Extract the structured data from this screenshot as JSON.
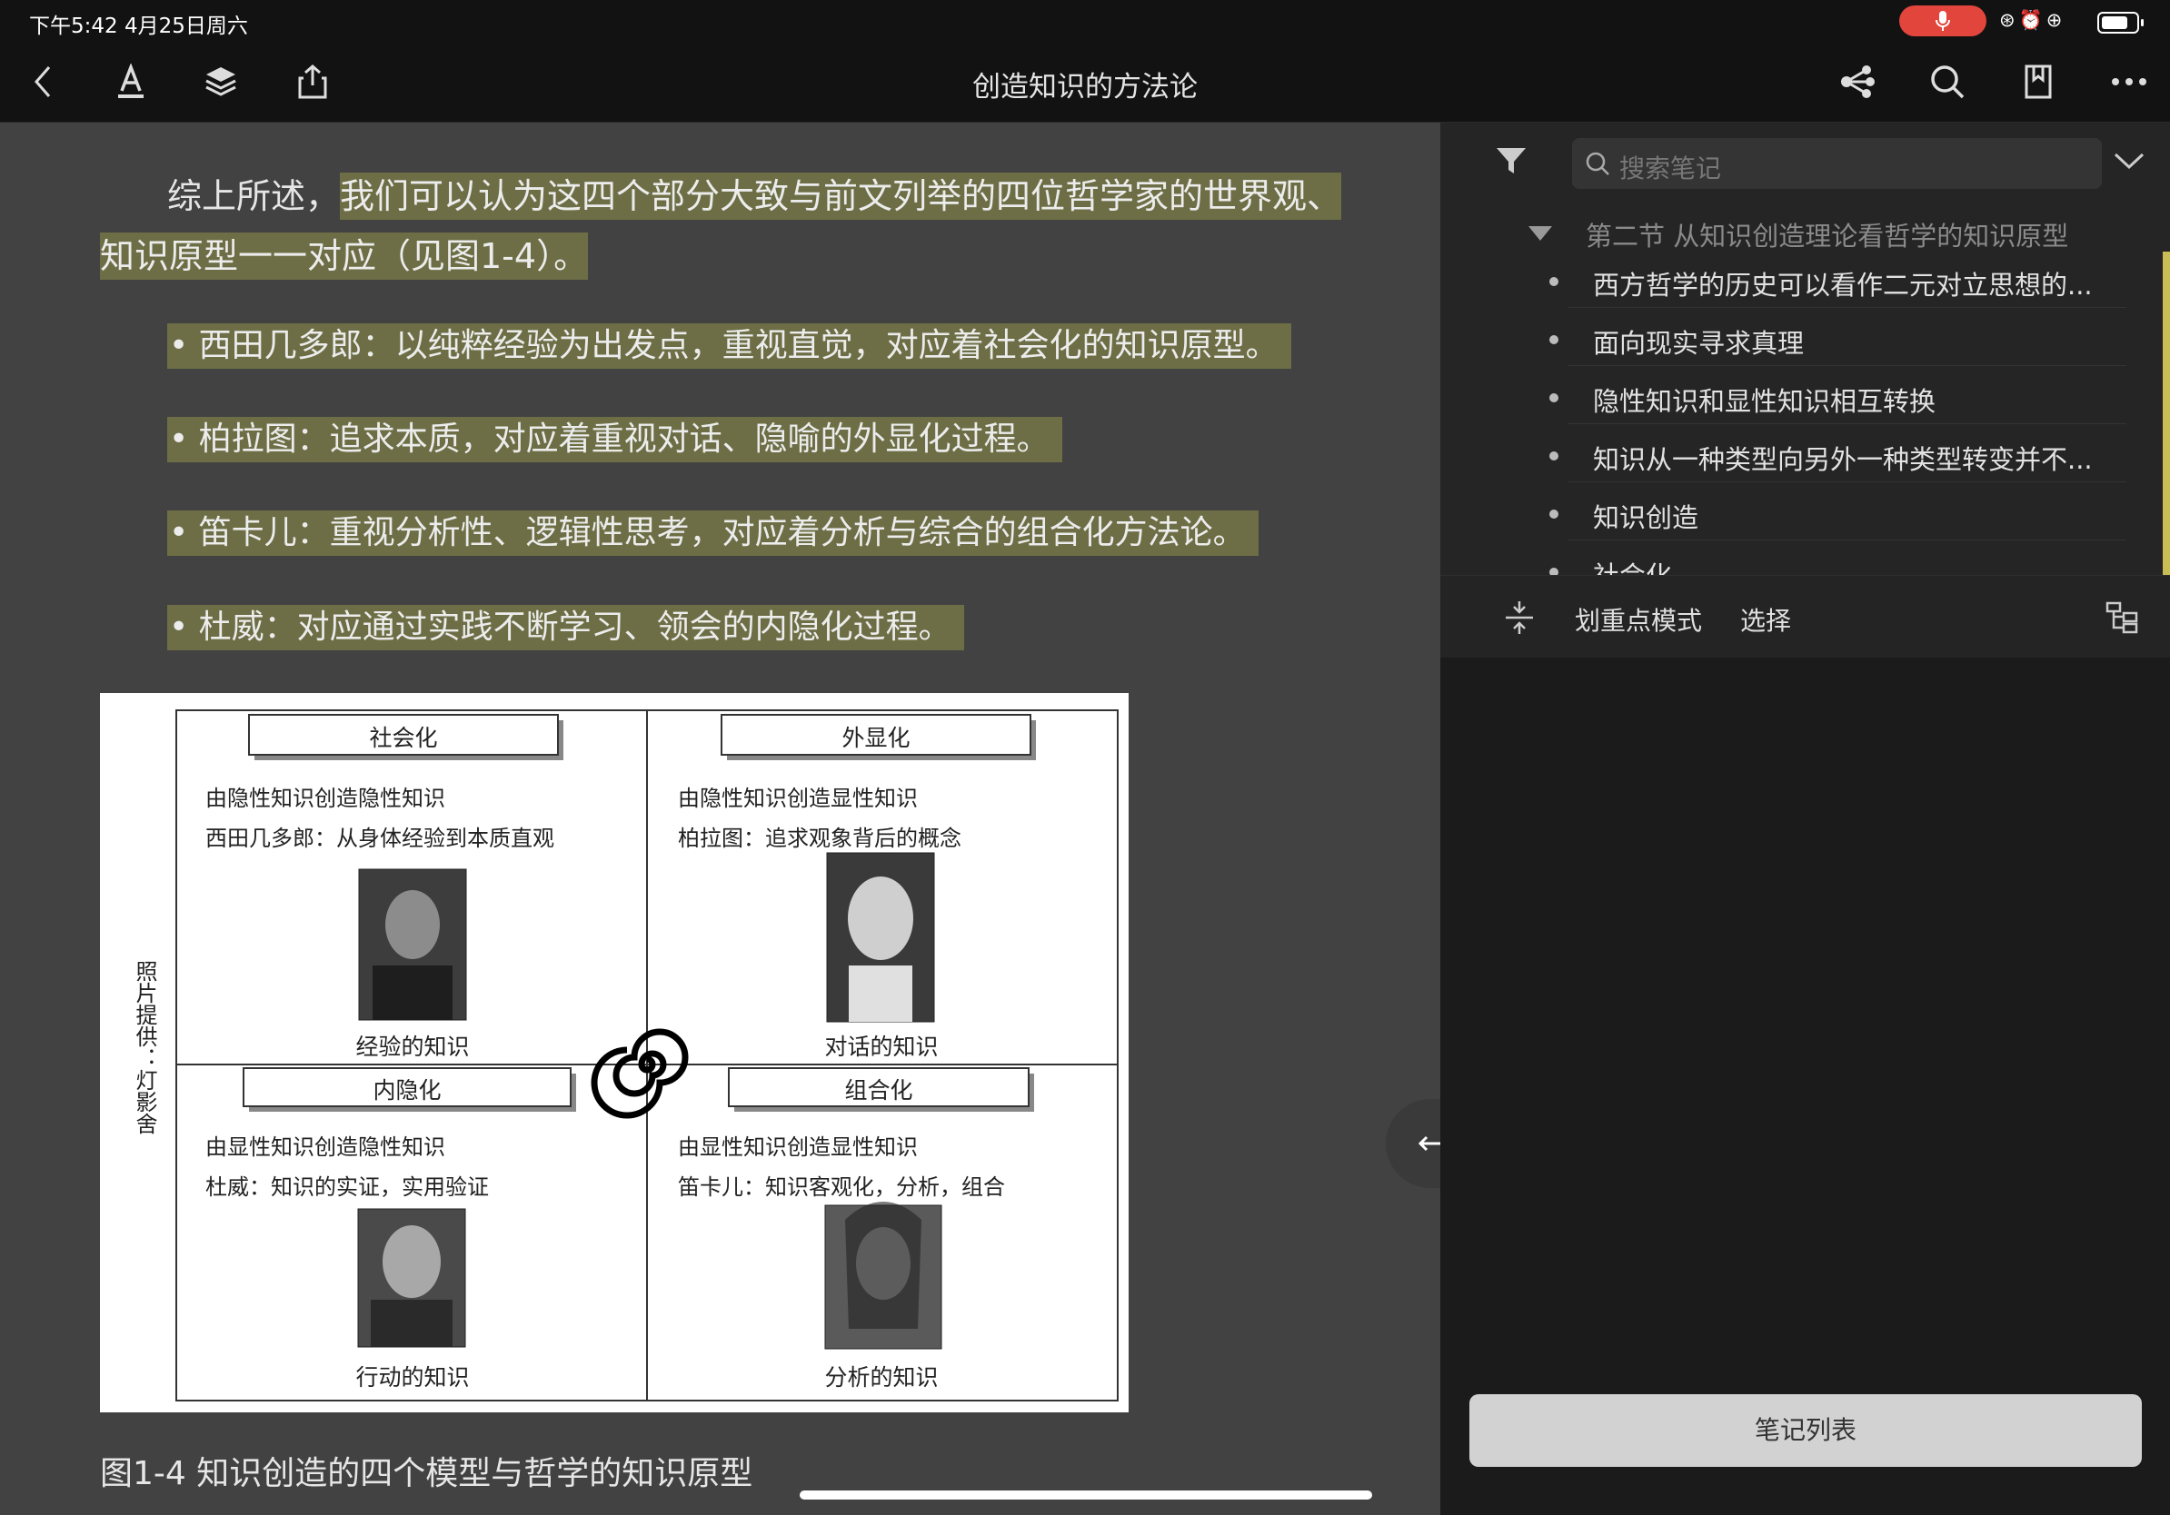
{
  "status_bar": {
    "time": "下午5:42  4月25日周六"
  },
  "toolbar": {
    "title": "创造知识的方法论"
  },
  "reader": {
    "para_plain": "综上所述，",
    "para_highlight": "我们可以认为这四个部分大致与前文列举的四位哲学家的世界观、知识原型一一对应（见图1-4）。",
    "bullets": [
      "• 西田几多郎：以纯粹经验为出发点，重视直觉，对应着社会化的知识原型。",
      "• 柏拉图：追求本质，对应着重视对话、隐喻的外显化过程。",
      "• 笛卡儿：重视分析性、逻辑性思考，对应着分析与综合的组合化方法论。",
      "• 杜威：对应通过实践不断学习、领会的内隐化过程。"
    ],
    "figure": {
      "side_label": "照片提供：灯影舍",
      "quadrants": [
        {
          "title": "社会化",
          "line1": "由隐性知识创造隐性知识",
          "line2": "西田几多郎：从身体经验到本质直观",
          "caption": "经验的知识"
        },
        {
          "title": "外显化",
          "line1": "由隐性知识创造显性知识",
          "line2": "柏拉图：追求观象背后的概念",
          "caption": "对话的知识"
        },
        {
          "title": "内隐化",
          "line1": "由显性知识创造隐性知识",
          "line2": "杜威：知识的实证，实用验证",
          "caption": "行动的知识"
        },
        {
          "title": "组合化",
          "line1": "由显性知识创造显性知识",
          "line2": "笛卡儿：知识客观化，分析，组合",
          "caption": "分析的知识"
        }
      ]
    },
    "figure_caption": "图1-4 知识创造的四个模型与哲学的知识原型"
  },
  "notes_panel": {
    "search_placeholder": "搜索笔记",
    "section_title": "第二节 从知识创造理论看哲学的知识原型",
    "items": [
      "西方哲学的历史可以看作二元对立思想的...",
      "面向现实寻求真理",
      "隐性知识和显性知识相互转换",
      "知识从一种类型向另外一种类型转变并不...",
      "知识创造",
      "社会化"
    ],
    "mode_label": "划重点模式",
    "select_label": "选择",
    "notes_list_button": "笔记列表"
  },
  "colors": {
    "highlight": "#6d6e45",
    "accent_bar": "#c9be55",
    "mic": "#e2453c"
  }
}
